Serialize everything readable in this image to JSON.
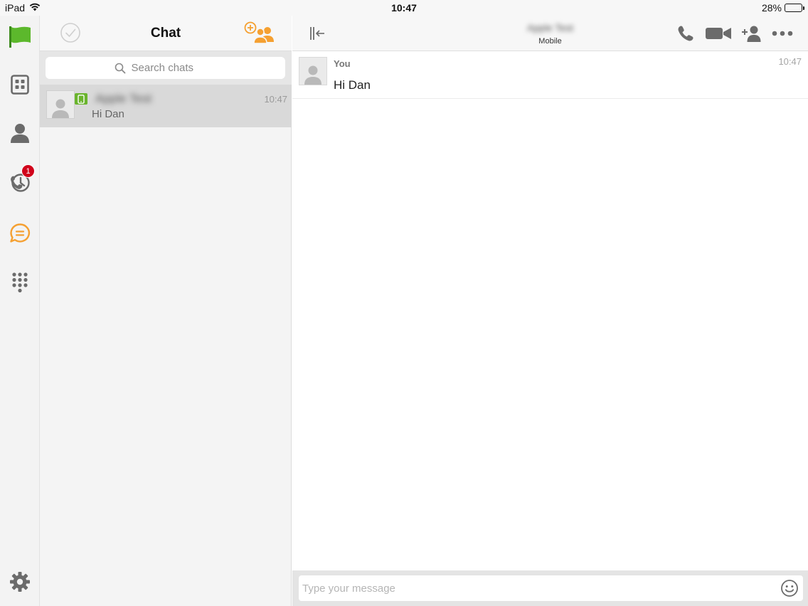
{
  "status_bar": {
    "device": "iPad",
    "time": "10:47",
    "battery_percent_label": "28%",
    "battery_level": 0.28
  },
  "rail": {
    "recents_badge": "1"
  },
  "chat_list": {
    "title": "Chat",
    "search": {
      "placeholder": "Search chats"
    },
    "items": [
      {
        "name": "Apple Test",
        "time": "10:47",
        "preview": "Hi Dan"
      }
    ]
  },
  "conversation": {
    "contact_name": "Apple Test",
    "contact_subtitle": "Mobile",
    "messages": [
      {
        "sender": "You",
        "time": "10:47",
        "text": "Hi Dan"
      }
    ],
    "composer": {
      "placeholder": "Type your message"
    }
  },
  "colors": {
    "accent_orange": "#f5a031",
    "brand_green": "#5cb82c",
    "badge_red": "#d0021b",
    "icon_gray": "#6b6b6b"
  }
}
